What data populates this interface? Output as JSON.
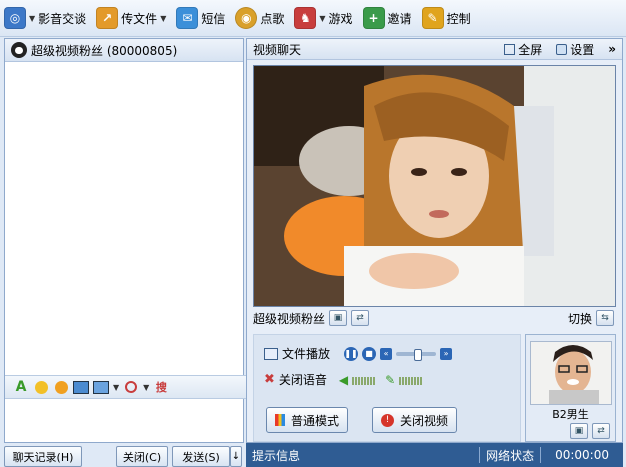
{
  "toolbar": {
    "items": [
      {
        "icon": "video-chat-icon",
        "label": "影音交谈",
        "color": "#3c78c8",
        "caret": true
      },
      {
        "icon": "send-file-icon",
        "label": "传文件",
        "color": "#e39a2a",
        "caret": true
      },
      {
        "icon": "sms-icon",
        "label": "短信",
        "color": "#3b8fd9",
        "caret": false
      },
      {
        "icon": "song-icon",
        "label": "点歌",
        "color": "#d9a02a",
        "caret": false
      },
      {
        "icon": "game-icon",
        "label": "游戏",
        "color": "#c83d3d",
        "caret": true
      },
      {
        "icon": "invite-icon",
        "label": "邀请",
        "color": "#3a9b4a",
        "caret": false
      },
      {
        "icon": "control-icon",
        "label": "控制",
        "color": "#e0a41e",
        "caret": false
      }
    ]
  },
  "chat": {
    "header": "超级视频粉丝 (80000805)"
  },
  "format_bar": {
    "font_glyph": "A"
  },
  "buttons": {
    "history": "聊天记录(H)",
    "close": "关闭(C)",
    "send": "发送(S)",
    "send_arrow": "↓"
  },
  "video_panel": {
    "title": "视频聊天",
    "fullscreen": "全屏",
    "settings": "设置",
    "expand": "»",
    "peer_name": "超级视频粉丝",
    "switch": "切换"
  },
  "controls": {
    "file_play": "文件播放",
    "mute_voice": "关闭语音",
    "mode_button": "普通模式",
    "close_video_button": "关闭视频",
    "playback_progress": 0.55
  },
  "self_view": {
    "name": "B2男生"
  },
  "status": {
    "tip": "提示信息",
    "network": "网络状态",
    "time": "00:00:00"
  }
}
